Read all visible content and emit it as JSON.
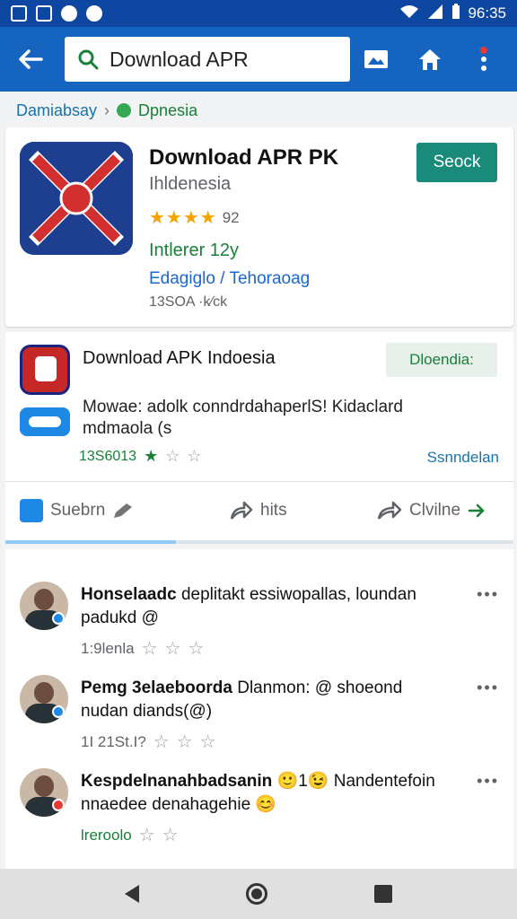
{
  "status_bar": {
    "time": "96:35"
  },
  "search": {
    "query": "Download APR"
  },
  "breadcrumb": {
    "root": "Damiabsay",
    "location": "Dpnesia"
  },
  "app_card": {
    "title": "Download APR PK",
    "subtitle": "Ihldenesia",
    "rating_count": "92",
    "stars": 4,
    "green_text": "Intlerer 12y",
    "link_text": "Edagiglo / Tehoraoag",
    "number": "13SOA ·k⁄ck",
    "button_label": "Seock",
    "accent_color": "#1a8a7a"
  },
  "apk_card": {
    "title": "Download APK Indoesia",
    "tag": "Dloendia:",
    "description_line1": "Mowae: adolk conndrdahaperlS! Kidaclard",
    "description_line2": "mdmaola (s",
    "meta_count": "13S6013",
    "right_link": "Ssnndelan",
    "actions": {
      "like": "Suebrn",
      "share": "hits",
      "more": "Clvilne"
    }
  },
  "comments": [
    {
      "author": "Honselaadc",
      "text_rest": "deplitakt essiwopallas, loundan",
      "line2": "padukd @",
      "meta": "1:9lenla"
    },
    {
      "author": "Pemg 3elaeboorda",
      "text_rest": "Dlanmon: @ shoeond",
      "line2": "nudan diands(@)",
      "meta": "1I 21St.I?"
    },
    {
      "author": "Kespdelnanahbadsanin",
      "text_rest": "🙂1😉 Nandentefoin",
      "line2": "nnaedee denahagehie 😊",
      "meta": "lreroolo"
    }
  ]
}
